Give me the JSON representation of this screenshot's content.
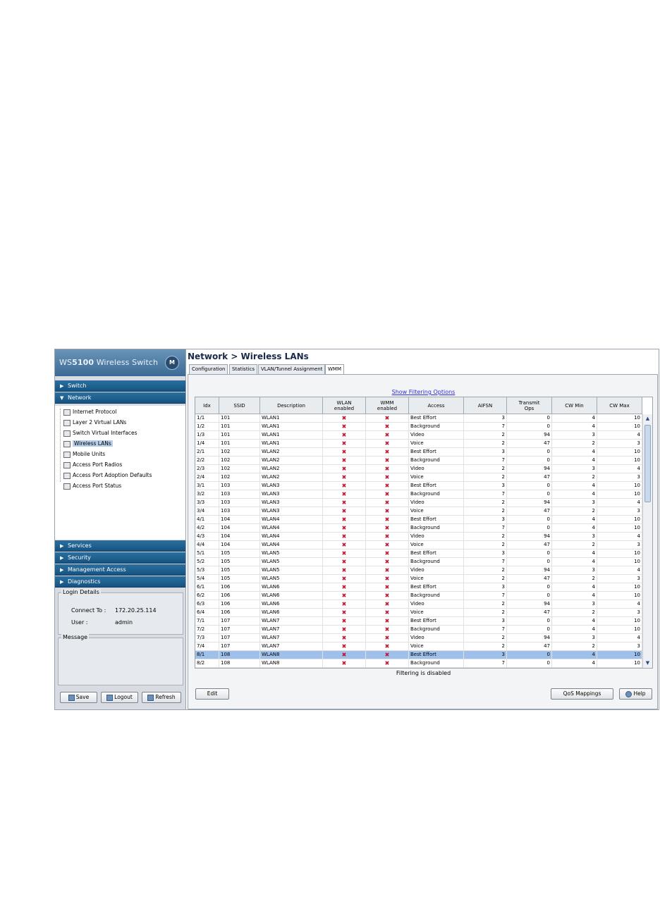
{
  "brand": {
    "prefix": "WS",
    "model": "5100",
    "suffix": "Wireless Switch",
    "logo": "M"
  },
  "nav": {
    "sections_top": [
      {
        "label": "Switch",
        "arrow": "▶"
      },
      {
        "label": "Network",
        "arrow": "▼"
      }
    ],
    "tree": [
      {
        "label": "Internet Protocol",
        "icon": "ip-icon"
      },
      {
        "label": "Layer 2 Virtual LANs",
        "icon": "vlan-icon"
      },
      {
        "label": "Switch Virtual Interfaces",
        "icon": "svi-icon"
      },
      {
        "label": "Wireless LANs",
        "icon": "wlan-icon",
        "selected": true
      },
      {
        "label": "Mobile Units",
        "icon": "mobile-icon"
      },
      {
        "label": "Access Port Radios",
        "icon": "radio-icon"
      },
      {
        "label": "Access Port Adoption Defaults",
        "icon": "adoption-icon"
      },
      {
        "label": "Access Port Status",
        "icon": "status-icon"
      }
    ],
    "sections_bottom": [
      {
        "label": "Services",
        "arrow": "▶"
      },
      {
        "label": "Security",
        "arrow": "▶"
      },
      {
        "label": "Management Access",
        "arrow": "▶"
      },
      {
        "label": "Diagnostics",
        "arrow": "▶"
      }
    ]
  },
  "login": {
    "legend": "Login Details",
    "connect_label": "Connect To :",
    "connect_value": "172.20.25.114",
    "user_label": "User :",
    "user_value": "admin"
  },
  "message": {
    "legend": "Message"
  },
  "left_buttons": {
    "save": "Save",
    "logout": "Logout",
    "refresh": "Refresh"
  },
  "title": "Network > Wireless LANs",
  "tabs": [
    "Configuration",
    "Statistics",
    "VLAN/Tunnel Assignment",
    "WMM"
  ],
  "active_tab": "WMM",
  "filter_link": "Show Filtering Options",
  "table": {
    "columns": [
      "Idx",
      "SSID",
      "Description",
      "WLAN\nenabled",
      "WMM\nenabled",
      "Access",
      "AIFSN",
      "Transmit\nOps",
      "CW Min",
      "CW Max"
    ],
    "rows": [
      [
        "1/1",
        "101",
        "WLAN1",
        "✖",
        "✖",
        "Best Effort",
        "3",
        "0",
        "4",
        "10"
      ],
      [
        "1/2",
        "101",
        "WLAN1",
        "✖",
        "✖",
        "Background",
        "7",
        "0",
        "4",
        "10"
      ],
      [
        "1/3",
        "101",
        "WLAN1",
        "✖",
        "✖",
        "Video",
        "2",
        "94",
        "3",
        "4"
      ],
      [
        "1/4",
        "101",
        "WLAN1",
        "✖",
        "✖",
        "Voice",
        "2",
        "47",
        "2",
        "3"
      ],
      [
        "2/1",
        "102",
        "WLAN2",
        "✖",
        "✖",
        "Best Effort",
        "3",
        "0",
        "4",
        "10"
      ],
      [
        "2/2",
        "102",
        "WLAN2",
        "✖",
        "✖",
        "Background",
        "7",
        "0",
        "4",
        "10"
      ],
      [
        "2/3",
        "102",
        "WLAN2",
        "✖",
        "✖",
        "Video",
        "2",
        "94",
        "3",
        "4"
      ],
      [
        "2/4",
        "102",
        "WLAN2",
        "✖",
        "✖",
        "Voice",
        "2",
        "47",
        "2",
        "3"
      ],
      [
        "3/1",
        "103",
        "WLAN3",
        "✖",
        "✖",
        "Best Effort",
        "3",
        "0",
        "4",
        "10"
      ],
      [
        "3/2",
        "103",
        "WLAN3",
        "✖",
        "✖",
        "Background",
        "7",
        "0",
        "4",
        "10"
      ],
      [
        "3/3",
        "103",
        "WLAN3",
        "✖",
        "✖",
        "Video",
        "2",
        "94",
        "3",
        "4"
      ],
      [
        "3/4",
        "103",
        "WLAN3",
        "✖",
        "✖",
        "Voice",
        "2",
        "47",
        "2",
        "3"
      ],
      [
        "4/1",
        "104",
        "WLAN4",
        "✖",
        "✖",
        "Best Effort",
        "3",
        "0",
        "4",
        "10"
      ],
      [
        "4/2",
        "104",
        "WLAN4",
        "✖",
        "✖",
        "Background",
        "7",
        "0",
        "4",
        "10"
      ],
      [
        "4/3",
        "104",
        "WLAN4",
        "✖",
        "✖",
        "Video",
        "2",
        "94",
        "3",
        "4"
      ],
      [
        "4/4",
        "104",
        "WLAN4",
        "✖",
        "✖",
        "Voice",
        "2",
        "47",
        "2",
        "3"
      ],
      [
        "5/1",
        "105",
        "WLAN5",
        "✖",
        "✖",
        "Best Effort",
        "3",
        "0",
        "4",
        "10"
      ],
      [
        "5/2",
        "105",
        "WLAN5",
        "✖",
        "✖",
        "Background",
        "7",
        "0",
        "4",
        "10"
      ],
      [
        "5/3",
        "105",
        "WLAN5",
        "✖",
        "✖",
        "Video",
        "2",
        "94",
        "3",
        "4"
      ],
      [
        "5/4",
        "105",
        "WLAN5",
        "✖",
        "✖",
        "Voice",
        "2",
        "47",
        "2",
        "3"
      ],
      [
        "6/1",
        "106",
        "WLAN6",
        "✖",
        "✖",
        "Best Effort",
        "3",
        "0",
        "4",
        "10"
      ],
      [
        "6/2",
        "106",
        "WLAN6",
        "✖",
        "✖",
        "Background",
        "7",
        "0",
        "4",
        "10"
      ],
      [
        "6/3",
        "106",
        "WLAN6",
        "✖",
        "✖",
        "Video",
        "2",
        "94",
        "3",
        "4"
      ],
      [
        "6/4",
        "106",
        "WLAN6",
        "✖",
        "✖",
        "Voice",
        "2",
        "47",
        "2",
        "3"
      ],
      [
        "7/1",
        "107",
        "WLAN7",
        "✖",
        "✖",
        "Best Effort",
        "3",
        "0",
        "4",
        "10"
      ],
      [
        "7/2",
        "107",
        "WLAN7",
        "✖",
        "✖",
        "Background",
        "7",
        "0",
        "4",
        "10"
      ],
      [
        "7/3",
        "107",
        "WLAN7",
        "✖",
        "✖",
        "Video",
        "2",
        "94",
        "3",
        "4"
      ],
      [
        "7/4",
        "107",
        "WLAN7",
        "✖",
        "✖",
        "Voice",
        "2",
        "47",
        "2",
        "3"
      ],
      [
        "8/1",
        "108",
        "WLAN8",
        "✖",
        "✖",
        "Best Effort",
        "3",
        "0",
        "4",
        "10"
      ],
      [
        "8/2",
        "108",
        "WLAN8",
        "✖",
        "✖",
        "Background",
        "7",
        "0",
        "4",
        "10"
      ]
    ],
    "selected_row": 28
  },
  "filter_status": "Filtering is disabled",
  "buttons": {
    "edit": "Edit",
    "qos": "QoS Mappings",
    "help": "Help"
  },
  "colors": {
    "nav_blue": "#165482",
    "selected_row": "#9ec0ea",
    "x_mark": "#c8102e"
  }
}
